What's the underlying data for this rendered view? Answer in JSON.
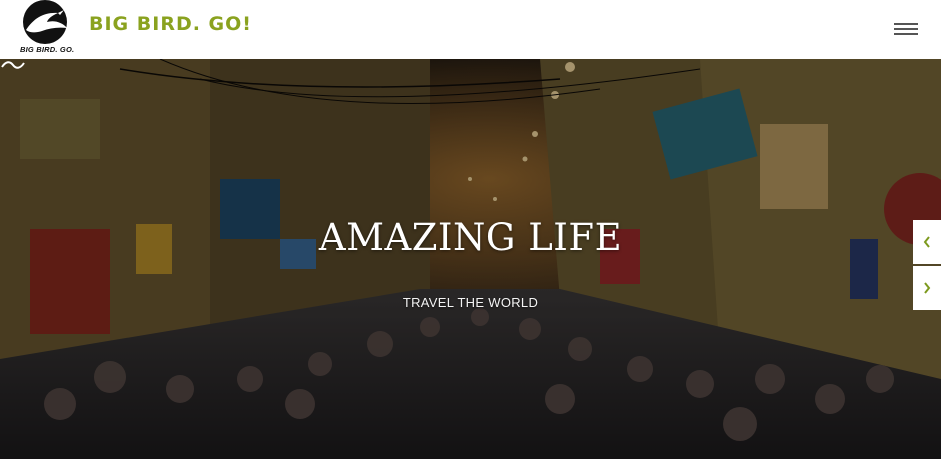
{
  "header": {
    "logo_caption": "BIG BIRD. GO.",
    "brand_name": "BIG BIRD. GO!",
    "menu_icon": "hamburger-menu-icon"
  },
  "hero": {
    "title": "AMAZING LIFE",
    "subtitle": "TRAVEL THE WORLD",
    "divider_icon": "tilde-icon",
    "prev_icon": "chevron-left-icon",
    "next_icon": "chevron-right-icon"
  },
  "colors": {
    "brand_green": "#8aa21f",
    "header_bg": "#ffffff",
    "arrow_green": "#7d9a1e",
    "menu_gray": "#555555"
  }
}
